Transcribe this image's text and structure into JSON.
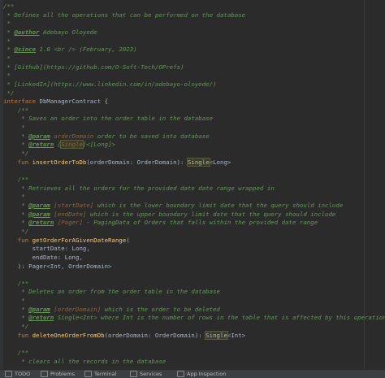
{
  "lines": [
    {
      "parts": [
        {
          "t": "/**",
          "c": "comment"
        }
      ]
    },
    {
      "parts": [
        {
          "t": " * Defines all the operations that can be performed on the database",
          "c": "comment"
        }
      ]
    },
    {
      "parts": [
        {
          "t": " *",
          "c": "comment"
        }
      ]
    },
    {
      "parts": [
        {
          "t": " * ",
          "c": "comment"
        },
        {
          "t": "@author",
          "c": "tag"
        },
        {
          "t": " Adebayo Oloyede",
          "c": "comment"
        }
      ]
    },
    {
      "parts": [
        {
          "t": " *",
          "c": "comment"
        }
      ]
    },
    {
      "parts": [
        {
          "t": " * ",
          "c": "comment"
        },
        {
          "t": "@since",
          "c": "tag"
        },
        {
          "t": " 1.0 <br /> (February, 2023)",
          "c": "comment"
        }
      ]
    },
    {
      "parts": [
        {
          "t": " *",
          "c": "comment"
        }
      ]
    },
    {
      "parts": [
        {
          "t": " * [Github](https://github.com/O-Soft-Tech/OPrefs)",
          "c": "comment"
        }
      ]
    },
    {
      "parts": [
        {
          "t": " *",
          "c": "comment"
        }
      ]
    },
    {
      "parts": [
        {
          "t": " * [LinkedIn](https://www.linkedin.com/in/adebayo-oloyede/)",
          "c": "comment"
        }
      ]
    },
    {
      "parts": [
        {
          "t": " */",
          "c": "comment"
        }
      ]
    },
    {
      "parts": [
        {
          "t": "interface ",
          "c": "kw"
        },
        {
          "t": "DbManagerContract {",
          "c": "type"
        }
      ]
    },
    {
      "parts": [
        {
          "t": "    /**",
          "c": "comment"
        }
      ]
    },
    {
      "parts": [
        {
          "t": "     * Saves an order into the order table in the database",
          "c": "comment"
        }
      ]
    },
    {
      "parts": [
        {
          "t": "     *",
          "c": "comment"
        }
      ]
    },
    {
      "parts": [
        {
          "t": "     * ",
          "c": "comment"
        },
        {
          "t": "@param",
          "c": "tag"
        },
        {
          "t": " orderDomain",
          "c": "param"
        },
        {
          "t": " order to be saved into database",
          "c": "comment"
        }
      ]
    },
    {
      "parts": [
        {
          "t": "     * ",
          "c": "comment"
        },
        {
          "t": "@return",
          "c": "tag"
        },
        {
          "t": " [",
          "c": "comment"
        },
        {
          "t": "Single",
          "c": "param hl"
        },
        {
          "t": "]<[Long]>",
          "c": "comment"
        }
      ]
    },
    {
      "parts": [
        {
          "t": "     */",
          "c": "comment"
        }
      ]
    },
    {
      "parts": [
        {
          "t": "    fun ",
          "c": "kw"
        },
        {
          "t": "insertOrderToDb",
          "c": "fn"
        },
        {
          "t": "(orderDomain: OrderDomain): ",
          "c": "type"
        },
        {
          "t": "Single",
          "c": "type hl"
        },
        {
          "t": "<Long>",
          "c": "type"
        }
      ]
    },
    {
      "parts": [
        {
          "t": "",
          "c": "comment"
        }
      ]
    },
    {
      "parts": [
        {
          "t": "    /**",
          "c": "comment"
        }
      ]
    },
    {
      "parts": [
        {
          "t": "     * Retrieves all the orders for the provided date date range wrapped in",
          "c": "comment"
        }
      ]
    },
    {
      "parts": [
        {
          "t": "     *",
          "c": "comment"
        }
      ]
    },
    {
      "parts": [
        {
          "t": "     * ",
          "c": "comment"
        },
        {
          "t": "@param",
          "c": "tag"
        },
        {
          "t": " [startDate]",
          "c": "param"
        },
        {
          "t": " which is the lower boundary limit date that the query should include",
          "c": "comment"
        }
      ]
    },
    {
      "parts": [
        {
          "t": "     * ",
          "c": "comment"
        },
        {
          "t": "@param",
          "c": "tag"
        },
        {
          "t": " [endDate]",
          "c": "param"
        },
        {
          "t": " which is the upper boundary limit date that the query should include",
          "c": "comment"
        }
      ]
    },
    {
      "parts": [
        {
          "t": "     * ",
          "c": "comment"
        },
        {
          "t": "@return",
          "c": "tag"
        },
        {
          "t": " [Pager]",
          "c": "param"
        },
        {
          "t": " - PagingData of Orders that falls within the provided date range",
          "c": "comment"
        }
      ]
    },
    {
      "parts": [
        {
          "t": "     */",
          "c": "comment"
        }
      ]
    },
    {
      "parts": [
        {
          "t": "    fun ",
          "c": "kw"
        },
        {
          "t": "getOrderForAGivenDateRange",
          "c": "fn"
        },
        {
          "t": "(",
          "c": "type"
        }
      ]
    },
    {
      "parts": [
        {
          "t": "        startDate: Long,",
          "c": "type"
        }
      ]
    },
    {
      "parts": [
        {
          "t": "        endDate: Long,",
          "c": "type"
        }
      ]
    },
    {
      "parts": [
        {
          "t": "    ): Pager<Int, OrderDomain>",
          "c": "type"
        }
      ]
    },
    {
      "parts": [
        {
          "t": "",
          "c": "comment"
        }
      ]
    },
    {
      "parts": [
        {
          "t": "    /**",
          "c": "comment"
        }
      ]
    },
    {
      "parts": [
        {
          "t": "     * Deletes an order from the order table in the database",
          "c": "comment"
        }
      ]
    },
    {
      "parts": [
        {
          "t": "     *",
          "c": "comment"
        }
      ]
    },
    {
      "parts": [
        {
          "t": "     * ",
          "c": "comment"
        },
        {
          "t": "@param",
          "c": "tag"
        },
        {
          "t": " [orderDomain]",
          "c": "param"
        },
        {
          "t": " which is the order to be deleted",
          "c": "comment"
        }
      ]
    },
    {
      "parts": [
        {
          "t": "     * ",
          "c": "comment"
        },
        {
          "t": "@return",
          "c": "tag"
        },
        {
          "t": " Single<Int> where Int is the number of rows in the table that is affected by this operation",
          "c": "comment"
        }
      ]
    },
    {
      "parts": [
        {
          "t": "     */",
          "c": "comment"
        }
      ]
    },
    {
      "parts": [
        {
          "t": "    fun ",
          "c": "kw"
        },
        {
          "t": "deleteOneOrderFromDb",
          "c": "fn"
        },
        {
          "t": "(orderDomain: OrderDomain): ",
          "c": "type"
        },
        {
          "t": "Single",
          "c": "type hl"
        },
        {
          "t": "<Int>",
          "c": "type"
        }
      ]
    },
    {
      "parts": [
        {
          "t": "",
          "c": "comment"
        }
      ]
    },
    {
      "parts": [
        {
          "t": "    /**",
          "c": "comment"
        }
      ]
    },
    {
      "parts": [
        {
          "t": "     * clears all the records in the database",
          "c": "comment"
        }
      ]
    }
  ],
  "bottom_bar": {
    "items": [
      {
        "label": "TODO",
        "icon": "todo-icon"
      },
      {
        "label": "Problems",
        "icon": "problems-icon"
      },
      {
        "label": "Terminal",
        "icon": "terminal-icon"
      },
      {
        "label": "Services",
        "icon": "services-icon"
      },
      {
        "label": "App Inspection",
        "icon": "app-inspection-icon"
      }
    ]
  },
  "colors": {
    "background": "#2b2b2b",
    "comment": "#629755",
    "keyword": "#cc7832",
    "function": "#ffc66d",
    "text": "#a9b7c6"
  }
}
